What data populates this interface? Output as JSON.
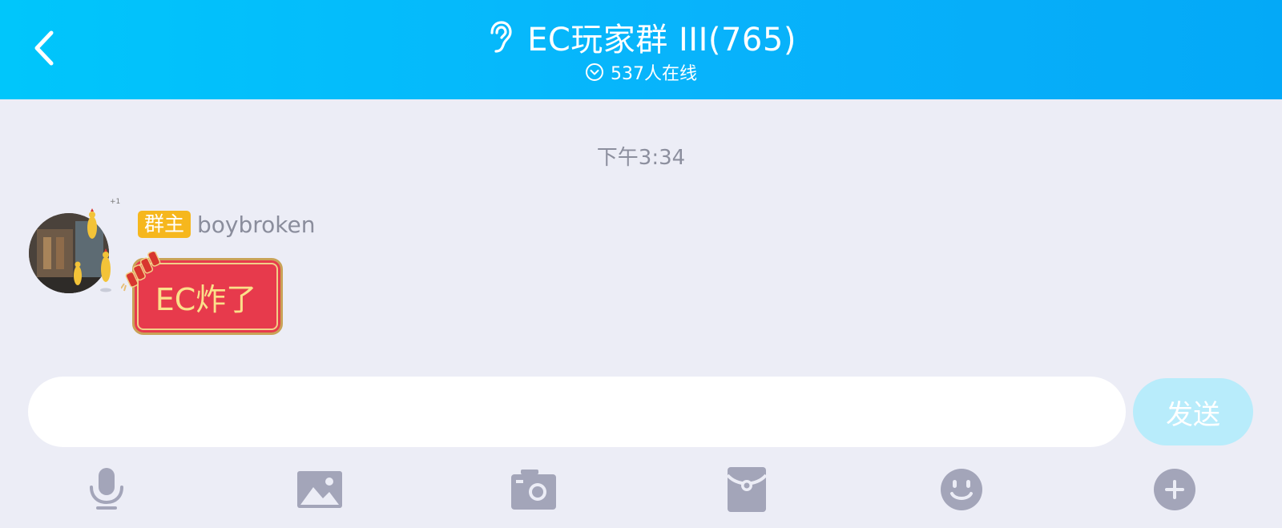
{
  "header": {
    "title": "EC玩家群 III(765)",
    "online_text": "537人在线",
    "back_icon": "chevron-left-icon",
    "title_icon": "ear-icon",
    "online_icon": "chevron-down-circle-icon"
  },
  "chat": {
    "timestamp": "下午3:34",
    "messages": [
      {
        "role_badge": "群主",
        "sender": "boybroken",
        "text": "EC炸了",
        "avatar_icon": "user-avatar"
      }
    ]
  },
  "composer": {
    "input_value": "",
    "input_placeholder": "",
    "send_label": "发送"
  },
  "toolbar": {
    "items": [
      "microphone-icon",
      "image-icon",
      "camera-icon",
      "red-packet-icon",
      "emoji-icon",
      "plus-icon"
    ]
  },
  "colors": {
    "header_start": "#00c6fb",
    "header_end": "#04a9f7",
    "background": "#ecedf6",
    "badge": "#f6b71d",
    "bubble": "#e73a4c",
    "bubble_text": "#fbe08a",
    "send_button": "#b8ecfb",
    "icon_gray": "#a3a5b9"
  }
}
